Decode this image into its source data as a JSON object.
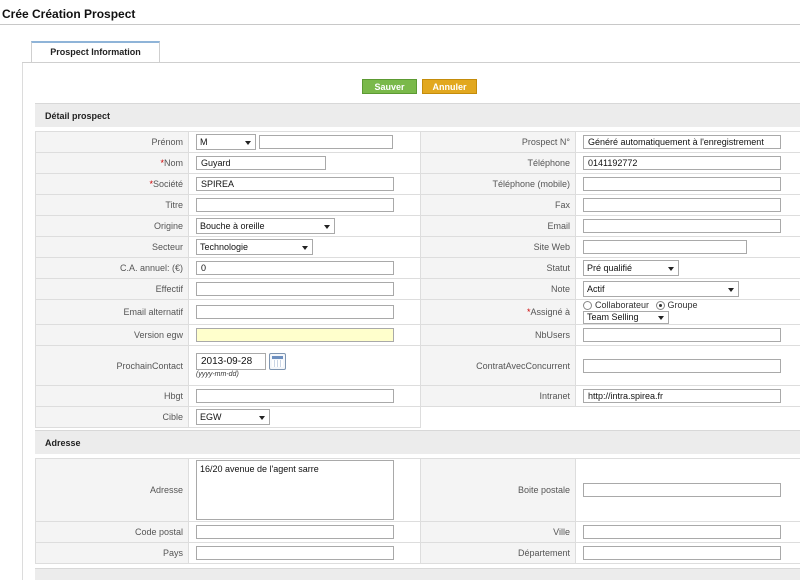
{
  "page": {
    "title": "Crée Création Prospect"
  },
  "tab": {
    "label": "Prospect Information"
  },
  "buttons": {
    "save": "Sauver",
    "cancel": "Annuler"
  },
  "sections": {
    "detail": "Détail prospect",
    "address": "Adresse"
  },
  "detail": {
    "prenom": {
      "label": "Prénom",
      "salutation": "M",
      "value": ""
    },
    "nom": {
      "label": "Nom",
      "value": "Guyard"
    },
    "societe": {
      "label": "Société",
      "value": "SPIREA"
    },
    "titre": {
      "label": "Titre",
      "value": ""
    },
    "origine": {
      "label": "Origine",
      "value": "Bouche à oreille"
    },
    "secteur": {
      "label": "Secteur",
      "value": "Technologie"
    },
    "ca": {
      "label": "C.A. annuel: (€)",
      "value": "0"
    },
    "effectif": {
      "label": "Effectif",
      "value": ""
    },
    "email_alt": {
      "label": "Email alternatif",
      "value": ""
    },
    "version_egw": {
      "label": "Version egw",
      "value": ""
    },
    "prochain_contact": {
      "label": "ProchainContact",
      "value": "2013-09-28",
      "hint": "(yyyy-mm-dd)"
    },
    "hbgt": {
      "label": "Hbgt",
      "value": ""
    },
    "cible": {
      "label": "Cible",
      "value": "EGW"
    },
    "prospect_no": {
      "label": "Prospect N°",
      "value": "Généré automatiquement à l'enregistrement"
    },
    "telephone": {
      "label": "Téléphone",
      "value": "0141192772"
    },
    "telephone_mobile": {
      "label": "Téléphone (mobile)",
      "value": ""
    },
    "fax": {
      "label": "Fax",
      "value": ""
    },
    "email": {
      "label": "Email",
      "value": ""
    },
    "site_web": {
      "label": "Site Web",
      "value": ""
    },
    "statut": {
      "label": "Statut",
      "value": "Pré qualifié"
    },
    "note": {
      "label": "Note",
      "value": "Actif"
    },
    "assigne": {
      "label": "Assigné à",
      "opt1": "Collaborateur",
      "opt2": "Groupe",
      "selected": "Groupe",
      "value": "Team Selling"
    },
    "nbusers": {
      "label": "NbUsers",
      "value": ""
    },
    "contrat": {
      "label": "ContratAvecConcurrent",
      "value": ""
    },
    "intranet": {
      "label": "Intranet",
      "value": "http://intra.spirea.fr"
    }
  },
  "address": {
    "adresse": {
      "label": "Adresse",
      "value": "16/20 avenue de l'agent sarre"
    },
    "code_postal": {
      "label": "Code postal",
      "value": ""
    },
    "pays": {
      "label": "Pays",
      "value": ""
    },
    "boite_postale": {
      "label": "Boite postale",
      "value": ""
    },
    "ville": {
      "label": "Ville",
      "value": ""
    },
    "departement": {
      "label": "Département",
      "value": ""
    }
  },
  "required_marker": "*"
}
